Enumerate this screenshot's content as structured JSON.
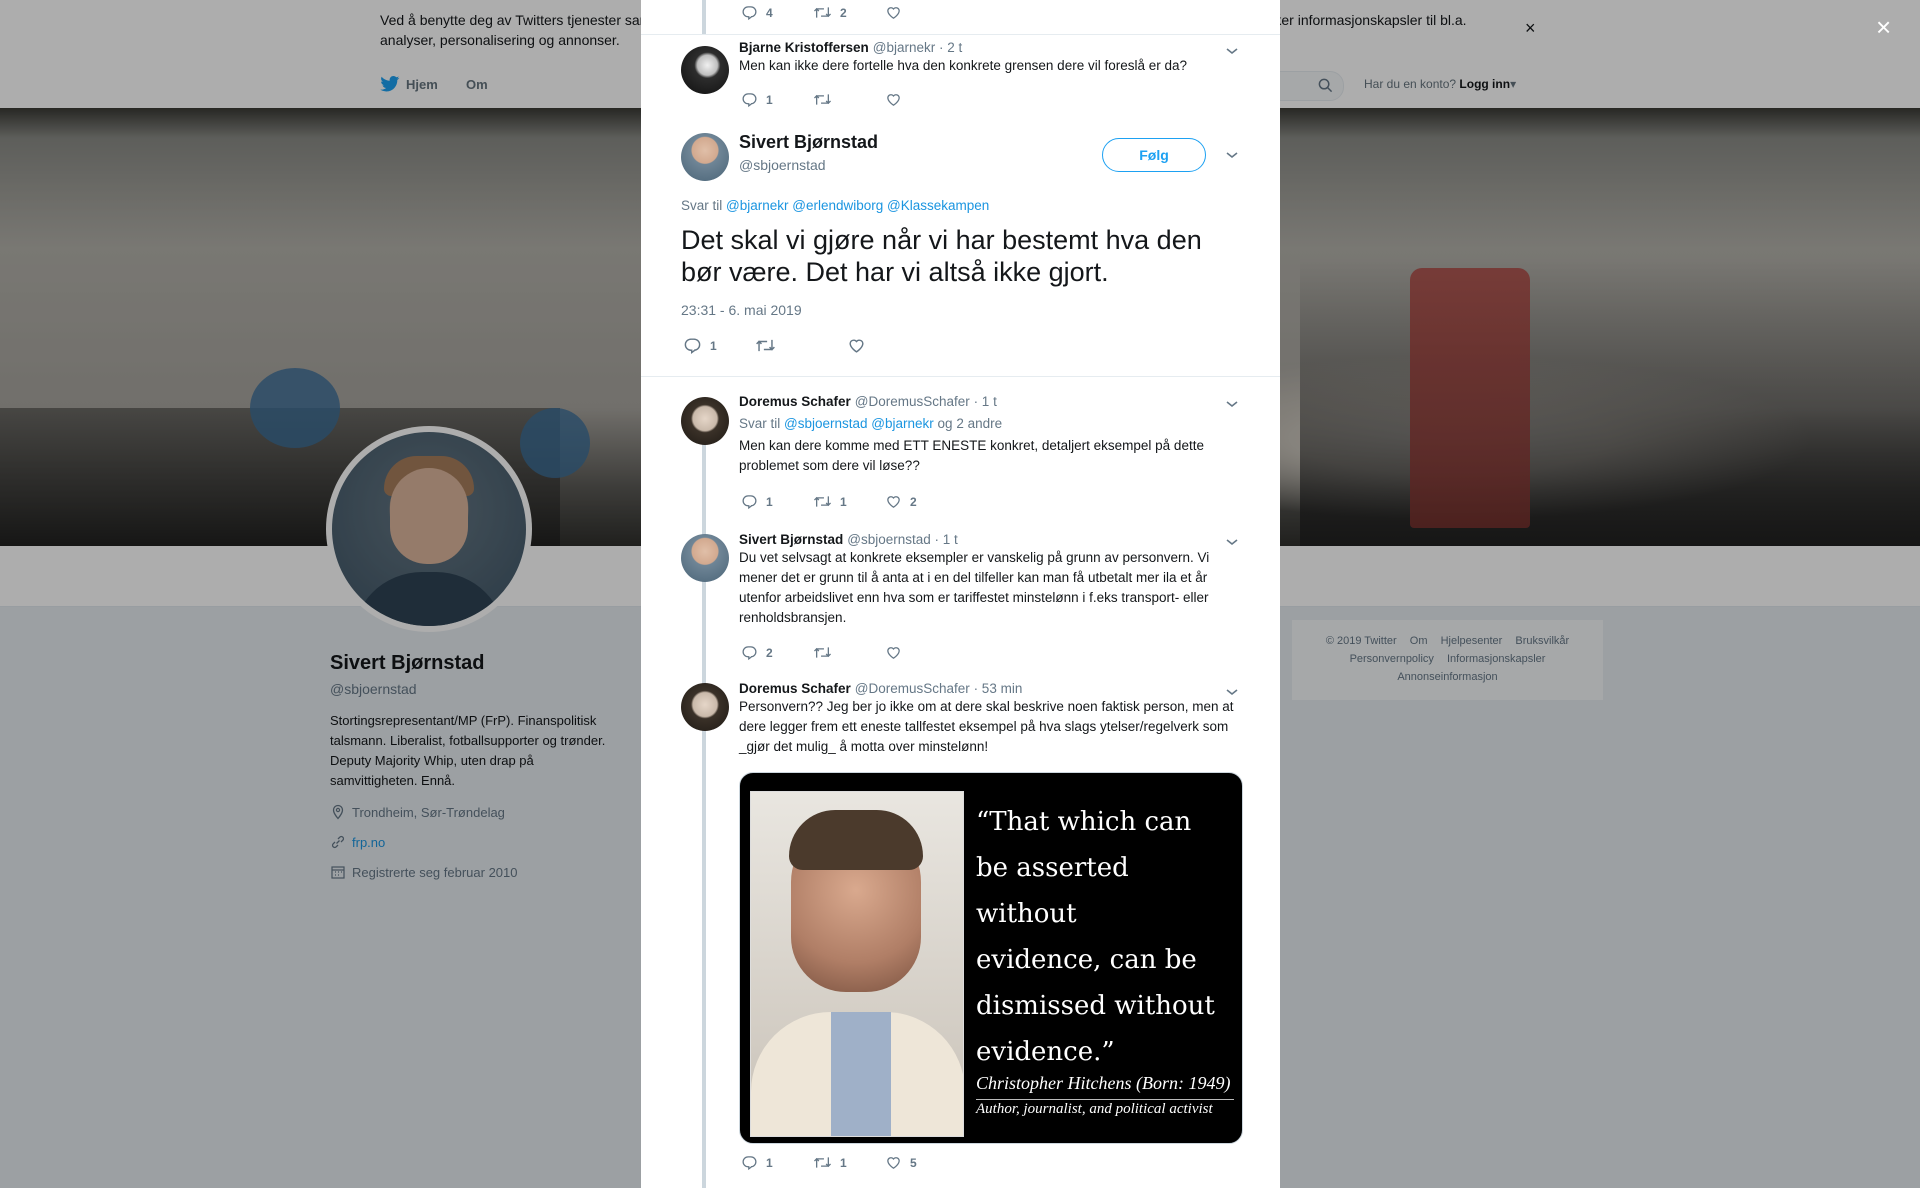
{
  "cookie_bar": {
    "text": "Ved å benytte deg av Twitters tjenester samtykker du i vår bruk av informasjonskapsler og overføring av data utenfor EU. Vi og våre partnere bruker informasjonskapsler til bl.a. analyser, personalisering og annonser.",
    "close": "×"
  },
  "topnav": {
    "home": "Hjem",
    "about": "Om",
    "login_prompt": "Har du en konto?",
    "login": "Logg inn"
  },
  "profile": {
    "name": "Sivert Bjørnstad",
    "handle": "@sbjoernstad",
    "bio": "Stortingsrepresentant/MP (FrP). Finanspolitisk talsmann. Liberalist, fotballsupporter og trønder. Deputy Majority Whip, uten drap på samvittigheten. Ennå.",
    "location": "Trondheim, Sør-Trøndelag",
    "website": "frp.no",
    "joined": "Registrerte seg februar 2010"
  },
  "footer": {
    "items": [
      "© 2019 Twitter",
      "Om",
      "Hjelpesenter",
      "Bruksvilkår",
      "Personvernpolicy",
      "Informasjonskapsler",
      "Annonseinformasjon"
    ]
  },
  "modal": {
    "close": "×",
    "top_actions": {
      "replies": "4",
      "retweets": "2",
      "likes": ""
    },
    "tweet_bjarne": {
      "name": "Bjarne Kristoffersen",
      "handle": "@bjarnekr",
      "time": "· 2 t",
      "text": "Men kan ikke dere fortelle hva den konkrete grensen dere vil foreslå er da?",
      "replies": "1",
      "retweets": "",
      "likes": ""
    },
    "main_tweet": {
      "name": "Sivert Bjørnstad",
      "handle": "@sbjoernstad",
      "follow": "Følg",
      "reply_prefix": "Svar til",
      "reply_users": [
        "@bjarnekr",
        "@erlendwiborg",
        "@Klassekampen"
      ],
      "text": "Det skal vi gjøre når vi har bestemt hva den bør være. Det har vi altså ikke gjort.",
      "timestamp": "23:31 - 6. mai 2019",
      "replies": "1",
      "retweets": "",
      "likes": ""
    },
    "tweet_doremus1": {
      "name": "Doremus Schafer",
      "handle": "@DoremusSchafer",
      "time": "· 1 t",
      "reply_prefix": "Svar til",
      "reply_users": [
        "@sbjoernstad",
        "@bjarnekr"
      ],
      "reply_suffix": "og 2 andre",
      "text": "Men kan dere komme med ETT ENESTE konkret, detaljert eksempel på dette problemet som dere vil løse??",
      "replies": "1",
      "retweets": "1",
      "likes": "2"
    },
    "tweet_sivert2": {
      "name": "Sivert Bjørnstad",
      "handle": "@sbjoernstad",
      "time": "· 1 t",
      "text": "Du vet selvsagt at konkrete eksempler er vanskelig på grunn av personvern. Vi mener det er grunn til å anta at i en del tilfeller kan man få utbetalt mer ila et år utenfor arbeidslivet enn hva som er tariffestet minstelønn i f.eks transport- eller renholdsbransjen.",
      "replies": "2",
      "retweets": "",
      "likes": ""
    },
    "tweet_doremus2": {
      "name": "Doremus Schafer",
      "handle": "@DoremusSchafer",
      "time": "· 53 min",
      "text": "Personvern?? Jeg ber jo ikke om at dere skal beskrive noen faktisk person, men at dere legger frem ett eneste tallfestet eksempel på hva slags ytelser/regelverk som _gjør det mulig_ å motta over minstelønn!",
      "image": {
        "quote_lines": [
          "“That which can",
          "be asserted without",
          "evidence, can be",
          "dismissed without",
          "evidence.”"
        ],
        "caption1": "Christopher Hitchens (Born: 1949)",
        "caption2": "Author, journalist, and political activist"
      },
      "replies": "1",
      "retweets": "1",
      "likes": "5"
    }
  },
  "colors": {
    "link": "#1b95e0",
    "follow": "#1da1f2",
    "muted": "#657786"
  },
  "icons": [
    "twitter-bird-icon",
    "search-icon",
    "reply-icon",
    "retweet-icon",
    "like-icon",
    "chevron-down-icon",
    "location-icon",
    "link-icon",
    "calendar-icon",
    "close-icon"
  ]
}
